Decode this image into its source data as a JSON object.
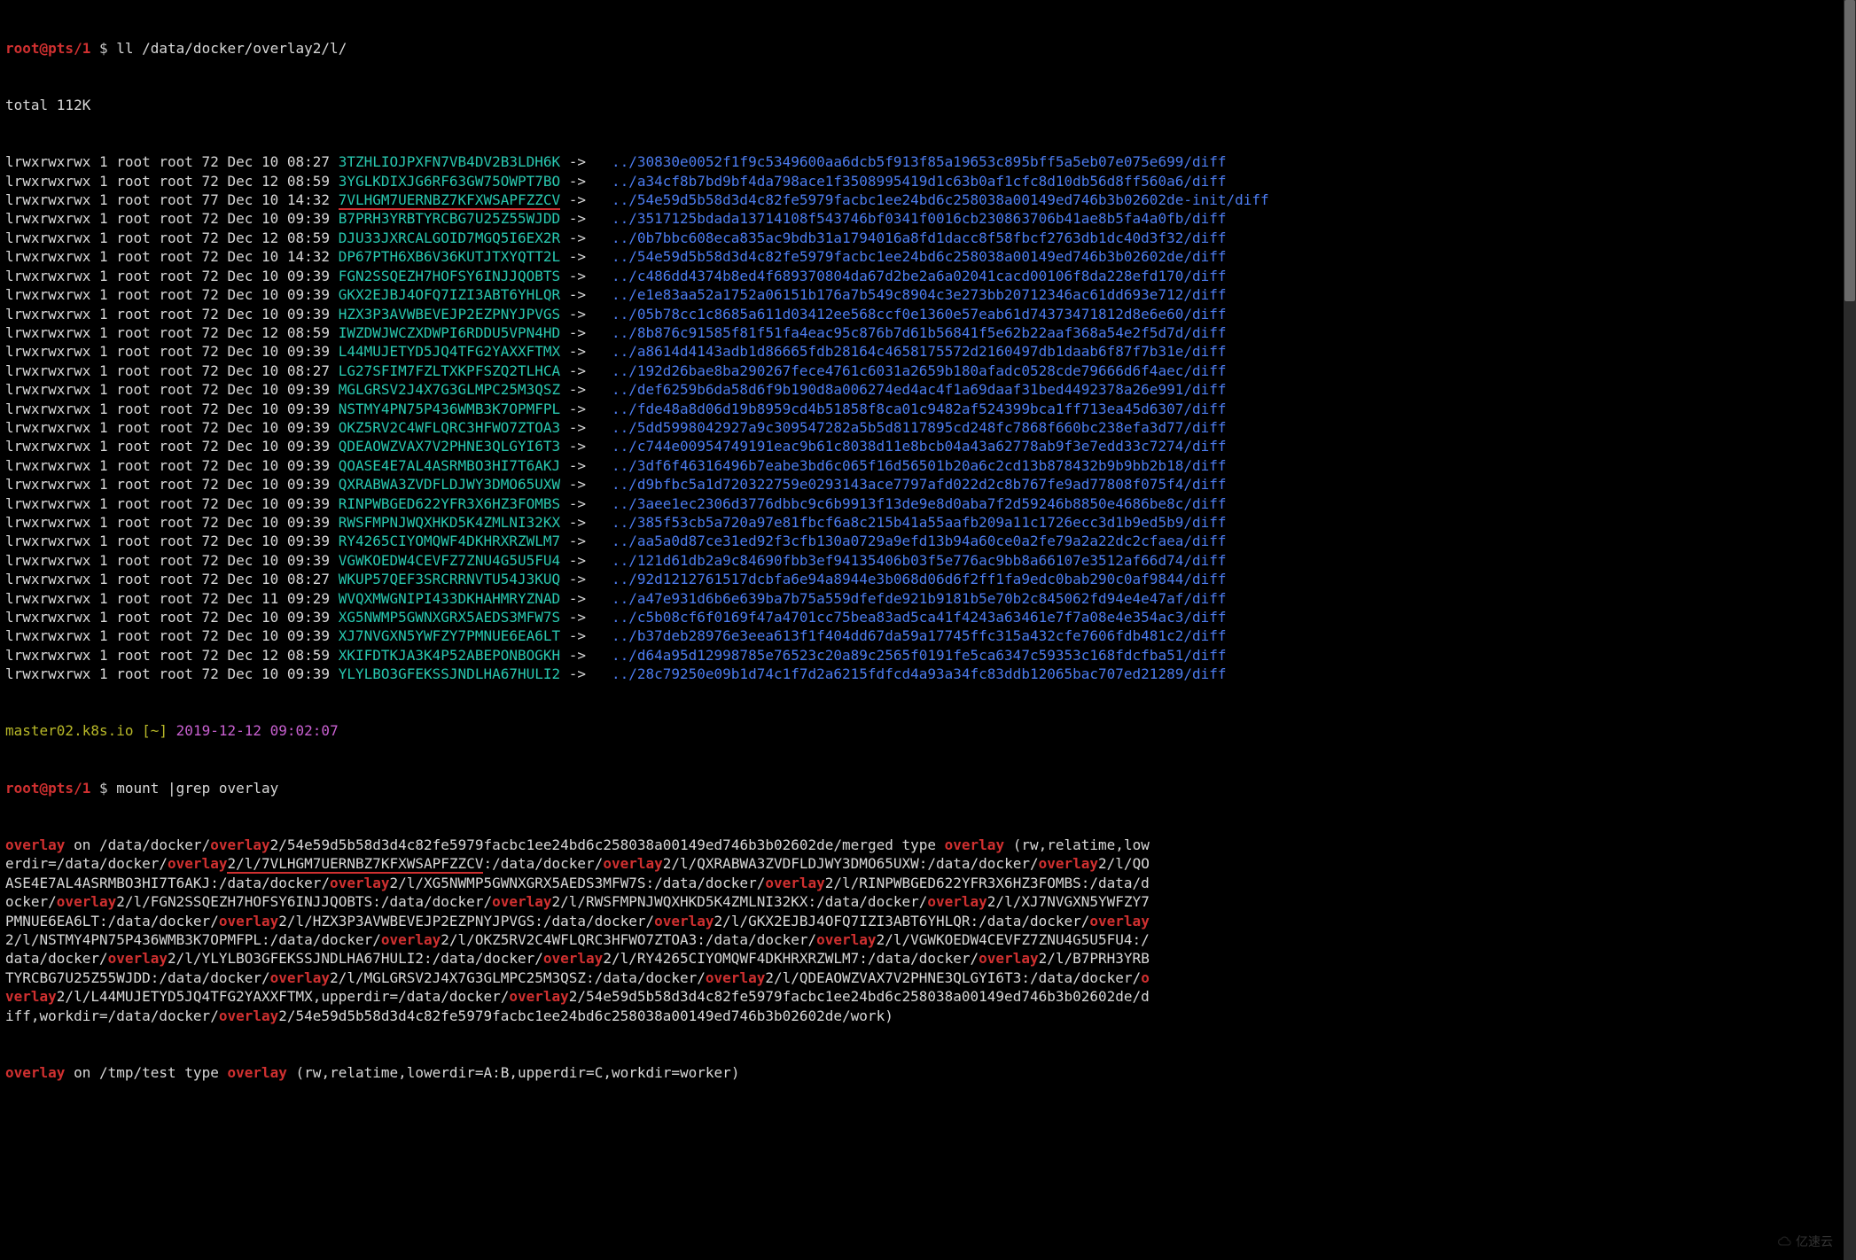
{
  "prompt1": {
    "user": "root@pts/1",
    "dollar": " $ ",
    "cmd": "ll /data/docker/overlay2/l/"
  },
  "total": "total 112K",
  "rows": [
    {
      "perm": "lrwxrwxrwx 1 root root 72 Dec 10 08:27 ",
      "name": "3TZHLIOJPXFN7VB4DV2B3LDH6K",
      "arrow": " -> ",
      "dots": "..",
      "c": "/",
      "hash": "30830e0052f1f9c5349600aa6dcb5f913f85a19653c895bff5a5eb07e075e699",
      "diff": "/diff"
    },
    {
      "perm": "lrwxrwxrwx 1 root root 72 Dec 12 08:59 ",
      "name": "3YGLKDIXJG6RF63GW75OWPT7BO",
      "arrow": " -> ",
      "dots": "..",
      "c": "/",
      "hash": "a34cf8b7bd9bf4da798ace1f3508995419d1c63b0af1cfc8d10db56d8ff560a6",
      "diff": "/diff"
    },
    {
      "perm": "lrwxrwxrwx 1 root root 77 Dec 10 14:32 ",
      "name": "7VLHGM7UERNBZ7KFXWSAPFZZCV",
      "arrow": " -> ",
      "dots": "..",
      "c": "/",
      "hash": "54e59d5b58d3d4c82fe5979facbc1ee24bd6c258038a00149ed746b3b02602de-init",
      "diff": "/diff",
      "u": true
    },
    {
      "perm": "lrwxrwxrwx 1 root root 72 Dec 10 09:39 ",
      "name": "B7PRH3YRBTYRCBG7U25Z55WJDD",
      "arrow": " -> ",
      "dots": "..",
      "c": "/",
      "hash": "3517125bdada13714108f543746bf0341f0016cb230863706b41ae8b5fa4a0fb",
      "diff": "/diff"
    },
    {
      "perm": "lrwxrwxrwx 1 root root 72 Dec 12 08:59 ",
      "name": "DJU33JXRCALGOID7MGQ5I6EX2R",
      "arrow": " -> ",
      "dots": "..",
      "c": "/",
      "hash": "0b7bbc608eca835ac9bdb31a1794016a8fd1dacc8f58fbcf2763db1dc40d3f32",
      "diff": "/diff"
    },
    {
      "perm": "lrwxrwxrwx 1 root root 72 Dec 10 14:32 ",
      "name": "DP67PTH6XB6V36KUTJTXYQTT2L",
      "arrow": " -> ",
      "dots": "..",
      "c": "/",
      "hash": "54e59d5b58d3d4c82fe5979facbc1ee24bd6c258038a00149ed746b3b02602de",
      "diff": "/diff"
    },
    {
      "perm": "lrwxrwxrwx 1 root root 72 Dec 10 09:39 ",
      "name": "FGN2SSQEZH7HOFSY6INJJQOBTS",
      "arrow": " -> ",
      "dots": "..",
      "c": "/",
      "hash": "c486dd4374b8ed4f689370804da67d2be2a6a02041cacd00106f8da228efd170",
      "diff": "/diff"
    },
    {
      "perm": "lrwxrwxrwx 1 root root 72 Dec 10 09:39 ",
      "name": "GKX2EJBJ4OFQ7IZI3ABT6YHLQR",
      "arrow": " -> ",
      "dots": "..",
      "c": "/",
      "hash": "e1e83aa52a1752a06151b176a7b549c8904c3e273bb20712346ac61dd693e712",
      "diff": "/diff"
    },
    {
      "perm": "lrwxrwxrwx 1 root root 72 Dec 10 09:39 ",
      "name": "HZX3P3AVWBEVEJP2EZPNYJPVGS",
      "arrow": " -> ",
      "dots": "..",
      "c": "/",
      "hash": "05b78cc1c8685a611d03412ee568ccf0e1360e57eab61d74373471812d8e6e60",
      "diff": "/diff"
    },
    {
      "perm": "lrwxrwxrwx 1 root root 72 Dec 12 08:59 ",
      "name": "IWZDWJWCZXDWPI6RDDU5VPN4HD",
      "arrow": " -> ",
      "dots": "..",
      "c": "/",
      "hash": "8b876c91585f81f51fa4eac95c876b7d61b56841f5e62b22aaf368a54e2f5d7d",
      "diff": "/diff"
    },
    {
      "perm": "lrwxrwxrwx 1 root root 72 Dec 10 09:39 ",
      "name": "L44MUJETYD5JQ4TFG2YAXXFTMX",
      "arrow": " -> ",
      "dots": "..",
      "c": "/",
      "hash": "a8614d4143adb1d86665fdb28164c4658175572d2160497db1daab6f87f7b31e",
      "diff": "/diff"
    },
    {
      "perm": "lrwxrwxrwx 1 root root 72 Dec 10 08:27 ",
      "name": "LG27SFIM7FZLTXKPFSZQ2TLHCA",
      "arrow": " -> ",
      "dots": "..",
      "c": "/",
      "hash": "192d26bae8ba290267fece4761c6031a2659b180afadc0528cde79666d6f4aec",
      "diff": "/diff"
    },
    {
      "perm": "lrwxrwxrwx 1 root root 72 Dec 10 09:39 ",
      "name": "MGLGRSV2J4X7G3GLMPC25M3QSZ",
      "arrow": " -> ",
      "dots": "..",
      "c": "/",
      "hash": "def6259b6da58d6f9b190d8a006274ed4ac4f1a69daaf31bed4492378a26e991",
      "diff": "/diff"
    },
    {
      "perm": "lrwxrwxrwx 1 root root 72 Dec 10 09:39 ",
      "name": "NSTMY4PN75P436WMB3K7OPMFPL",
      "arrow": " -> ",
      "dots": "..",
      "c": "/",
      "hash": "fde48a8d06d19b8959cd4b51858f8ca01c9482af524399bca1ff713ea45d6307",
      "diff": "/diff"
    },
    {
      "perm": "lrwxrwxrwx 1 root root 72 Dec 10 09:39 ",
      "name": "OKZ5RV2C4WFLQRC3HFWO7ZTOA3",
      "arrow": " -> ",
      "dots": "..",
      "c": "/",
      "hash": "5dd5998042927a9c309547282a5b5d8117895cd248fc7868f660bc238efa3d77",
      "diff": "/diff"
    },
    {
      "perm": "lrwxrwxrwx 1 root root 72 Dec 10 09:39 ",
      "name": "QDEAOWZVAX7V2PHNE3QLGYI6T3",
      "arrow": " -> ",
      "dots": "..",
      "c": "/",
      "hash": "c744e00954749191eac9b61c8038d11e8bcb04a43a62778ab9f3e7edd33c7274",
      "diff": "/diff"
    },
    {
      "perm": "lrwxrwxrwx 1 root root 72 Dec 10 09:39 ",
      "name": "QOASE4E7AL4ASRMBO3HI7T6AKJ",
      "arrow": " -> ",
      "dots": "..",
      "c": "/",
      "hash": "3df6f46316496b7eabe3bd6c065f16d56501b20a6c2cd13b878432b9b9bb2b18",
      "diff": "/diff"
    },
    {
      "perm": "lrwxrwxrwx 1 root root 72 Dec 10 09:39 ",
      "name": "QXRABWA3ZVDFLDJWY3DMO65UXW",
      "arrow": " -> ",
      "dots": "..",
      "c": "/",
      "hash": "d9bfbc5a1d720322759e0293143ace7797afd022d2c8b767fe9ad77808f075f4",
      "diff": "/diff"
    },
    {
      "perm": "lrwxrwxrwx 1 root root 72 Dec 10 09:39 ",
      "name": "RINPWBGED622YFR3X6HZ3FOMBS",
      "arrow": " -> ",
      "dots": "..",
      "c": "/",
      "hash": "3aee1ec2306d3776dbbc9c6b9913f13de9e8d0aba7f2d59246b8850e4686be8c",
      "diff": "/diff"
    },
    {
      "perm": "lrwxrwxrwx 1 root root 72 Dec 10 09:39 ",
      "name": "RWSFMPNJWQXHKD5K4ZMLNI32KX",
      "arrow": " -> ",
      "dots": "..",
      "c": "/",
      "hash": "385f53cb5a720a97e81fbcf6a8c215b41a55aafb209a11c1726ecc3d1b9ed5b9",
      "diff": "/diff"
    },
    {
      "perm": "lrwxrwxrwx 1 root root 72 Dec 10 09:39 ",
      "name": "RY4265CIYOMQWF4DKHRXRZWLM7",
      "arrow": " -> ",
      "dots": "..",
      "c": "/",
      "hash": "aa5a0d87ce31ed92f3cfb130a0729a9efd13b94a60ce0a2fe79a2a22dc2cfaea",
      "diff": "/diff"
    },
    {
      "perm": "lrwxrwxrwx 1 root root 72 Dec 10 09:39 ",
      "name": "VGWKOEDW4CEVFZ7ZNU4G5U5FU4",
      "arrow": " -> ",
      "dots": "..",
      "c": "/",
      "hash": "121d61db2a9c84690fbb3ef94135406b03f5e776ac9bb8a66107e3512af66d74",
      "diff": "/diff"
    },
    {
      "perm": "lrwxrwxrwx 1 root root 72 Dec 10 08:27 ",
      "name": "WKUP57QEF3SRCRRNVTU54J3KUQ",
      "arrow": " -> ",
      "dots": "..",
      "c": "/",
      "hash": "92d1212761517dcbfa6e94a8944e3b068d06d6f2ff1fa9edc0bab290c0af9844",
      "diff": "/diff"
    },
    {
      "perm": "lrwxrwxrwx 1 root root 72 Dec 11 09:29 ",
      "name": "WVQXMWGNIPI433DKHAHMRYZNAD",
      "arrow": " -> ",
      "dots": "..",
      "c": "/",
      "hash": "a47e931d6b6e639ba7b75a559dfefde921b9181b5e70b2c845062fd94e4e47af",
      "diff": "/diff"
    },
    {
      "perm": "lrwxrwxrwx 1 root root 72 Dec 10 09:39 ",
      "name": "XG5NWMP5GWNXGRX5AEDS3MFW7S",
      "arrow": " -> ",
      "dots": "..",
      "c": "/",
      "hash": "c5b08cf6f0169f47a4701cc75bea83ad5ca41f4243a63461e7f7a08e4e354ac3",
      "diff": "/diff"
    },
    {
      "perm": "lrwxrwxrwx 1 root root 72 Dec 10 09:39 ",
      "name": "XJ7NVGXN5YWFZY7PMNUE6EA6LT",
      "arrow": " -> ",
      "dots": "..",
      "c": "/",
      "hash": "b37deb28976e3eea613f1f404dd67da59a17745ffc315a432cfe7606fdb481c2",
      "diff": "/diff"
    },
    {
      "perm": "lrwxrwxrwx 1 root root 72 Dec 12 08:59 ",
      "name": "XKIFDTKJA3K4P52ABEPONBOGKH",
      "arrow": " -> ",
      "dots": "..",
      "c": "/",
      "hash": "d64a95d12998785e76523c20a89c2565f0191fe5ca6347c59353c168fdcfba51",
      "diff": "/diff"
    },
    {
      "perm": "lrwxrwxrwx 1 root root 72 Dec 10 09:39 ",
      "name": "YLYLBO3GFEKSSJNDLHA67HULI2",
      "arrow": " -> ",
      "dots": "..",
      "c": "/",
      "hash": "28c79250e09b1d74c1f7d2a6215fdfcd4a93a34fc83ddb12065bac707ed21289",
      "diff": "/diff"
    }
  ],
  "ps1": {
    "host": "master02.k8s.io",
    "tilde": " [~] ",
    "ts": "2019-12-12 09:02:07"
  },
  "prompt2": {
    "user": "root@pts/1",
    "dollar": " $ ",
    "cmd": "mount |grep overlay"
  },
  "mount_segments": [
    {
      "t": "ov",
      "v": "overlay"
    },
    {
      "t": "w",
      "v": " on /data/docker/"
    },
    {
      "t": "ov",
      "v": "overlay"
    },
    {
      "t": "w",
      "v": "2/54e59d5b58d3d4c82fe5979facbc1ee24bd6c258038a00149ed746b3b02602de/merged type "
    },
    {
      "t": "ov",
      "v": "overlay"
    },
    {
      "t": "w",
      "v": " (rw,relatime,lowerdir=/data/docker/"
    },
    {
      "t": "ov",
      "v": "overlay"
    },
    {
      "t": "w",
      "v": "2/l/7VLHGM7UERNBZ7KFXWSAPFZZCV",
      "u": true
    },
    {
      "t": "w",
      "v": ":/data/docker/"
    },
    {
      "t": "ov",
      "v": "overlay"
    },
    {
      "t": "w",
      "v": "2/l/QXRABWA3ZVDFLDJWY3DMO65UXW:/data/docker/"
    },
    {
      "t": "ov",
      "v": "overlay"
    },
    {
      "t": "w",
      "v": "2/l/QOASE4E7AL4ASRMBO3HI7T6AKJ:/data/docker/"
    },
    {
      "t": "ov",
      "v": "overlay"
    },
    {
      "t": "w",
      "v": "2/l/XG5NWMP5GWNXGRX5AEDS3MFW7S:/data/docker/"
    },
    {
      "t": "ov",
      "v": "overlay"
    },
    {
      "t": "w",
      "v": "2/l/RINPWBGED622YFR3X6HZ3FOMBS:/data/docker/"
    },
    {
      "t": "ov",
      "v": "overlay"
    },
    {
      "t": "w",
      "v": "2/l/FGN2SSQEZH7HOFSY6INJJQOBTS:/data/docker/"
    },
    {
      "t": "ov",
      "v": "overlay"
    },
    {
      "t": "w",
      "v": "2/l/RWSFMPNJWQXHKD5K4ZMLNI32KX:/data/docker/"
    },
    {
      "t": "ov",
      "v": "overlay"
    },
    {
      "t": "w",
      "v": "2/l/XJ7NVGXN5YWFZY7PMNUE6EA6LT:/data/docker/"
    },
    {
      "t": "ov",
      "v": "overlay"
    },
    {
      "t": "w",
      "v": "2/l/HZX3P3AVWBEVEJP2EZPNYJPVGS:/data/docker/"
    },
    {
      "t": "ov",
      "v": "overlay"
    },
    {
      "t": "w",
      "v": "2/l/GKX2EJBJ4OFQ7IZI3ABT6YHLQR:/data/docker/"
    },
    {
      "t": "ov",
      "v": "overlay"
    },
    {
      "t": "w",
      "v": "2/l/NSTMY4PN75P436WMB3K7OPMFPL:/data/docker/"
    },
    {
      "t": "ov",
      "v": "overlay"
    },
    {
      "t": "w",
      "v": "2/l/OKZ5RV2C4WFLQRC3HFWO7ZTOA3:/data/docker/"
    },
    {
      "t": "ov",
      "v": "overlay"
    },
    {
      "t": "w",
      "v": "2/l/VGWKOEDW4CEVFZ7ZNU4G5U5FU4:/data/docker/"
    },
    {
      "t": "ov",
      "v": "overlay"
    },
    {
      "t": "w",
      "v": "2/l/YLYLBO3GFEKSSJNDLHA67HULI2:/data/docker/"
    },
    {
      "t": "ov",
      "v": "overlay"
    },
    {
      "t": "w",
      "v": "2/l/RY4265CIYOMQWF4DKHRXRZWLM7:/data/docker/"
    },
    {
      "t": "ov",
      "v": "overlay"
    },
    {
      "t": "w",
      "v": "2/l/B7PRH3YRBTYRCBG7U25Z55WJDD:/data/docker/"
    },
    {
      "t": "ov",
      "v": "overlay"
    },
    {
      "t": "w",
      "v": "2/l/MGLGRSV2J4X7G3GLMPC25M3QSZ:/data/docker/"
    },
    {
      "t": "ov",
      "v": "overlay"
    },
    {
      "t": "w",
      "v": "2/l/QDEAOWZVAX7V2PHNE3QLGYI6T3:/data/docker/"
    },
    {
      "t": "ov",
      "v": "overlay"
    },
    {
      "t": "w",
      "v": "2/l/L44MUJETYD5JQ4TFG2YAXXFTMX,upperdir=/data/docker/"
    },
    {
      "t": "ov",
      "v": "overlay"
    },
    {
      "t": "w",
      "v": "2/54e59d5b58d3d4c82fe5979facbc1ee24bd6c258038a00149ed746b3b02602de/diff,workdir=/data/docker/"
    },
    {
      "t": "ov",
      "v": "overlay"
    },
    {
      "t": "w",
      "v": "2/54e59d5b58d3d4c82fe5979facbc1ee24bd6c258038a00149ed746b3b02602de/work)"
    }
  ],
  "mount2_segments": [
    {
      "t": "ov",
      "v": "overlay"
    },
    {
      "t": "w",
      "v": " on /tmp/test type "
    },
    {
      "t": "ov",
      "v": "overlay"
    },
    {
      "t": "w",
      "v": " (rw,relatime,lowerdir=A:B,upperdir=C,workdir=worker)"
    }
  ],
  "watermark": "亿速云"
}
